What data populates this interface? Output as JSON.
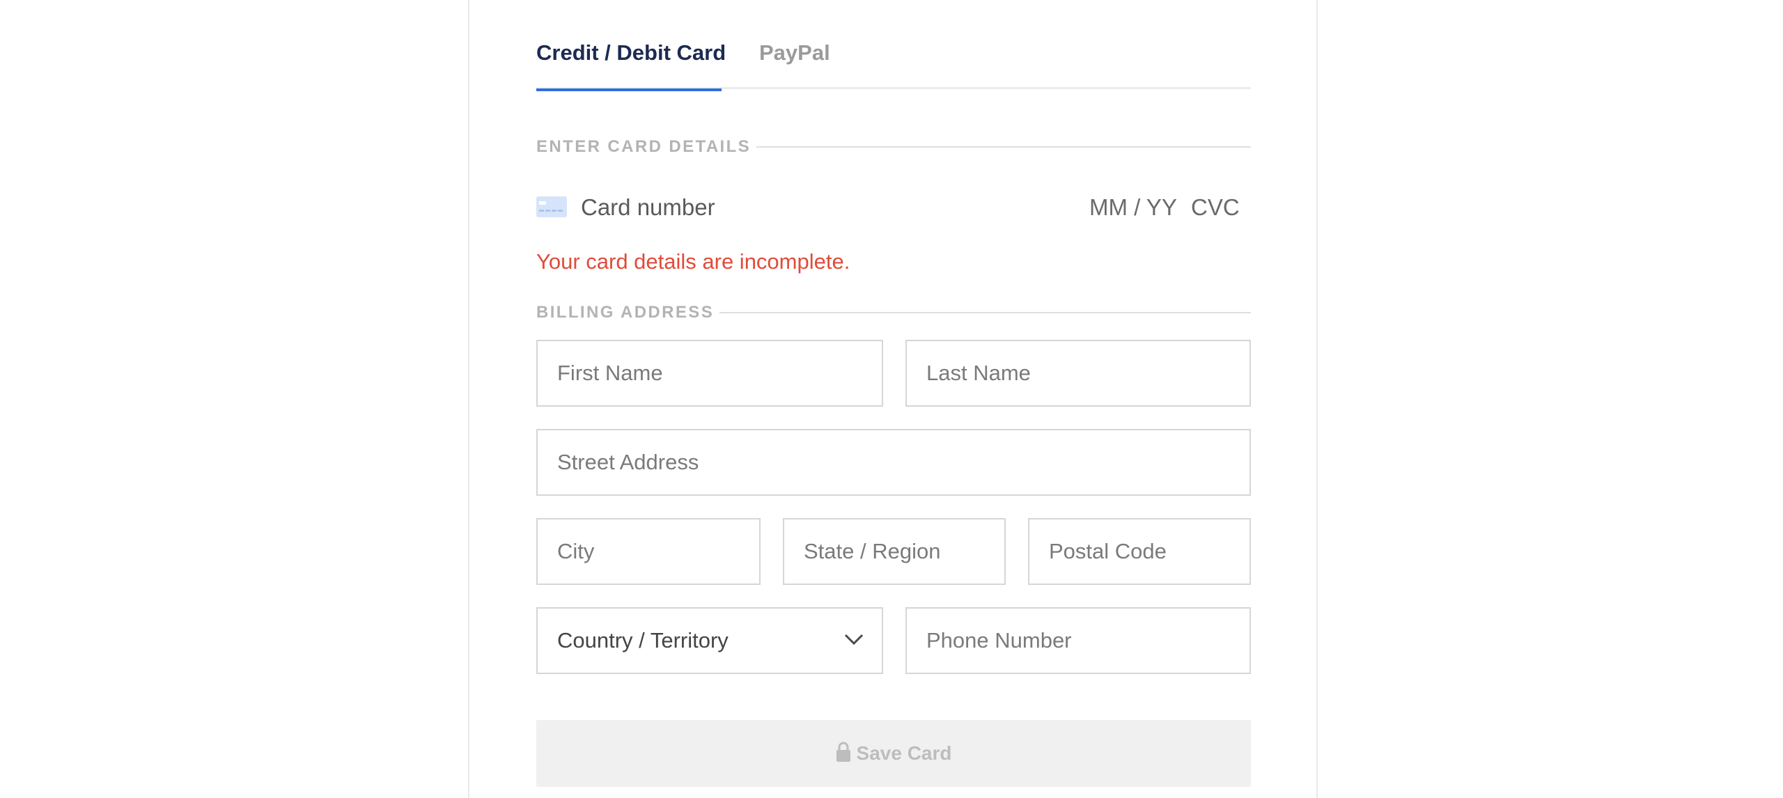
{
  "tabs": [
    {
      "label": "Credit / Debit Card",
      "active": true
    },
    {
      "label": "PayPal",
      "active": false
    }
  ],
  "card_section": {
    "header": "ENTER CARD DETAILS",
    "card_number_placeholder": "Card number",
    "expiry_placeholder": "MM / YY",
    "cvc_placeholder": "CVC",
    "error": "Your card details are incomplete."
  },
  "billing_section": {
    "header": "BILLING ADDRESS",
    "first_name_placeholder": "First Name",
    "last_name_placeholder": "Last Name",
    "street_placeholder": "Street Address",
    "city_placeholder": "City",
    "state_placeholder": "State / Region",
    "postal_placeholder": "Postal Code",
    "country_label": "Country / Territory",
    "phone_placeholder": "Phone Number"
  },
  "save_button": {
    "label": "Save Card",
    "icon": "lock-icon",
    "disabled": true
  },
  "colors": {
    "active_tab": "#1d2a52",
    "tab_underline": "#2d6fd8",
    "error": "#e14b3a",
    "muted": "#b3b3b3"
  }
}
